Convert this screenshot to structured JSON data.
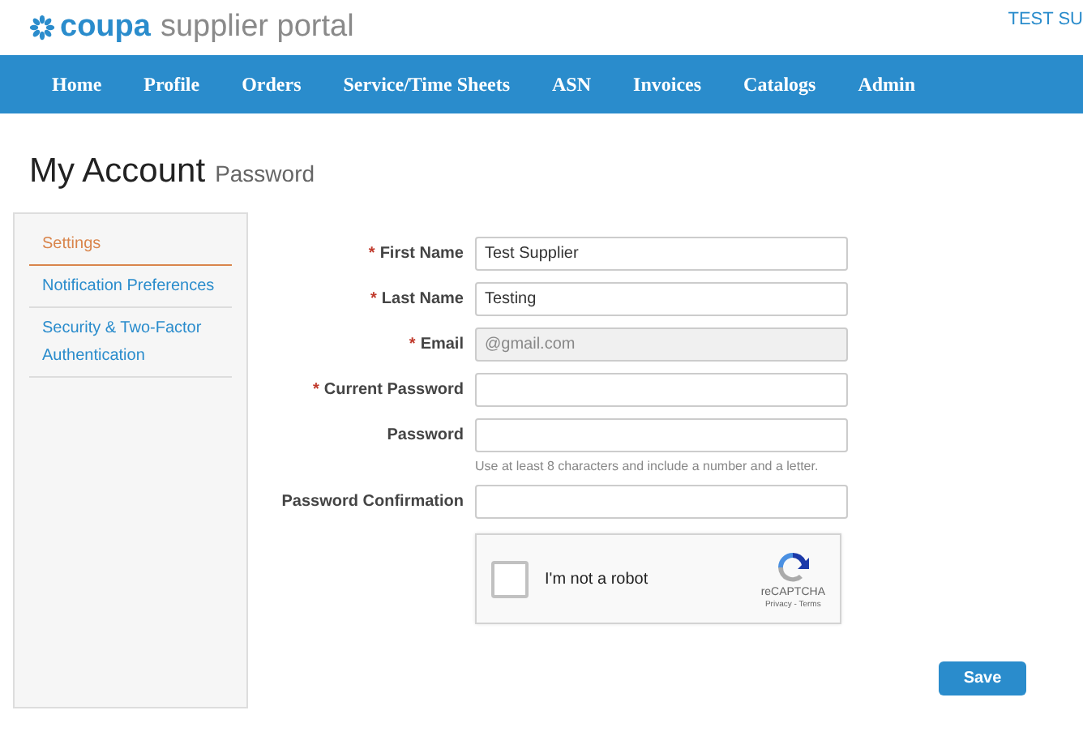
{
  "header": {
    "logo_brand": "coupa",
    "logo_product": "supplier portal",
    "user": "TEST SU"
  },
  "nav": [
    {
      "label": "Home"
    },
    {
      "label": "Profile"
    },
    {
      "label": "Orders"
    },
    {
      "label": "Service/Time Sheets"
    },
    {
      "label": "ASN"
    },
    {
      "label": "Invoices"
    },
    {
      "label": "Catalogs"
    },
    {
      "label": "Admin"
    }
  ],
  "page": {
    "title": "My Account",
    "subtitle": "Password"
  },
  "sidebar": {
    "items": [
      {
        "label": "Settings",
        "selected": true
      },
      {
        "label": "Notification Preferences",
        "selected": false
      },
      {
        "label": "Security & Two-Factor Authentication",
        "selected": false
      }
    ]
  },
  "form": {
    "fields": [
      {
        "label": "First Name",
        "required_mark": "*",
        "value": "Test Supplier",
        "disabled": false
      },
      {
        "label": "Last Name",
        "required_mark": "*",
        "value": "Testing",
        "disabled": false
      },
      {
        "label": "Email",
        "required_mark": "*",
        "value": "@gmail.com",
        "disabled": true
      },
      {
        "label": "Current Password",
        "required_mark": "*",
        "disabled": false
      },
      {
        "label": "Password",
        "disabled": false,
        "hint": "Use at least 8 characters and include a number and a letter."
      },
      {
        "label": "Password Confirmation",
        "disabled": false
      }
    ],
    "captcha": {
      "label": "I'm not a robot",
      "checked": false,
      "brand": "reCAPTCHA",
      "links": "Privacy - Terms"
    },
    "save": "Save"
  }
}
